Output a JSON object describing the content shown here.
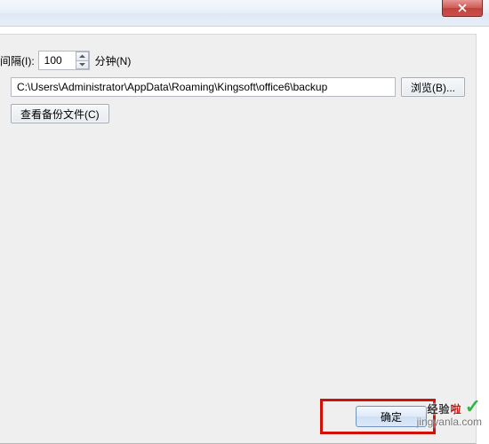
{
  "interval": {
    "label_left": "间隔(I):",
    "value": "100",
    "label_right": "分钟(N)"
  },
  "path": {
    "value": "C:\\Users\\Administrator\\AppData\\Roaming\\Kingsoft\\office6\\backup"
  },
  "buttons": {
    "browse": "浏览(B)...",
    "view_backup": "查看备份文件(C)",
    "ok": "确定"
  },
  "watermark": {
    "text_main": "经验",
    "text_accent": "啦",
    "check": "✓",
    "url": "jingyanla.com"
  }
}
